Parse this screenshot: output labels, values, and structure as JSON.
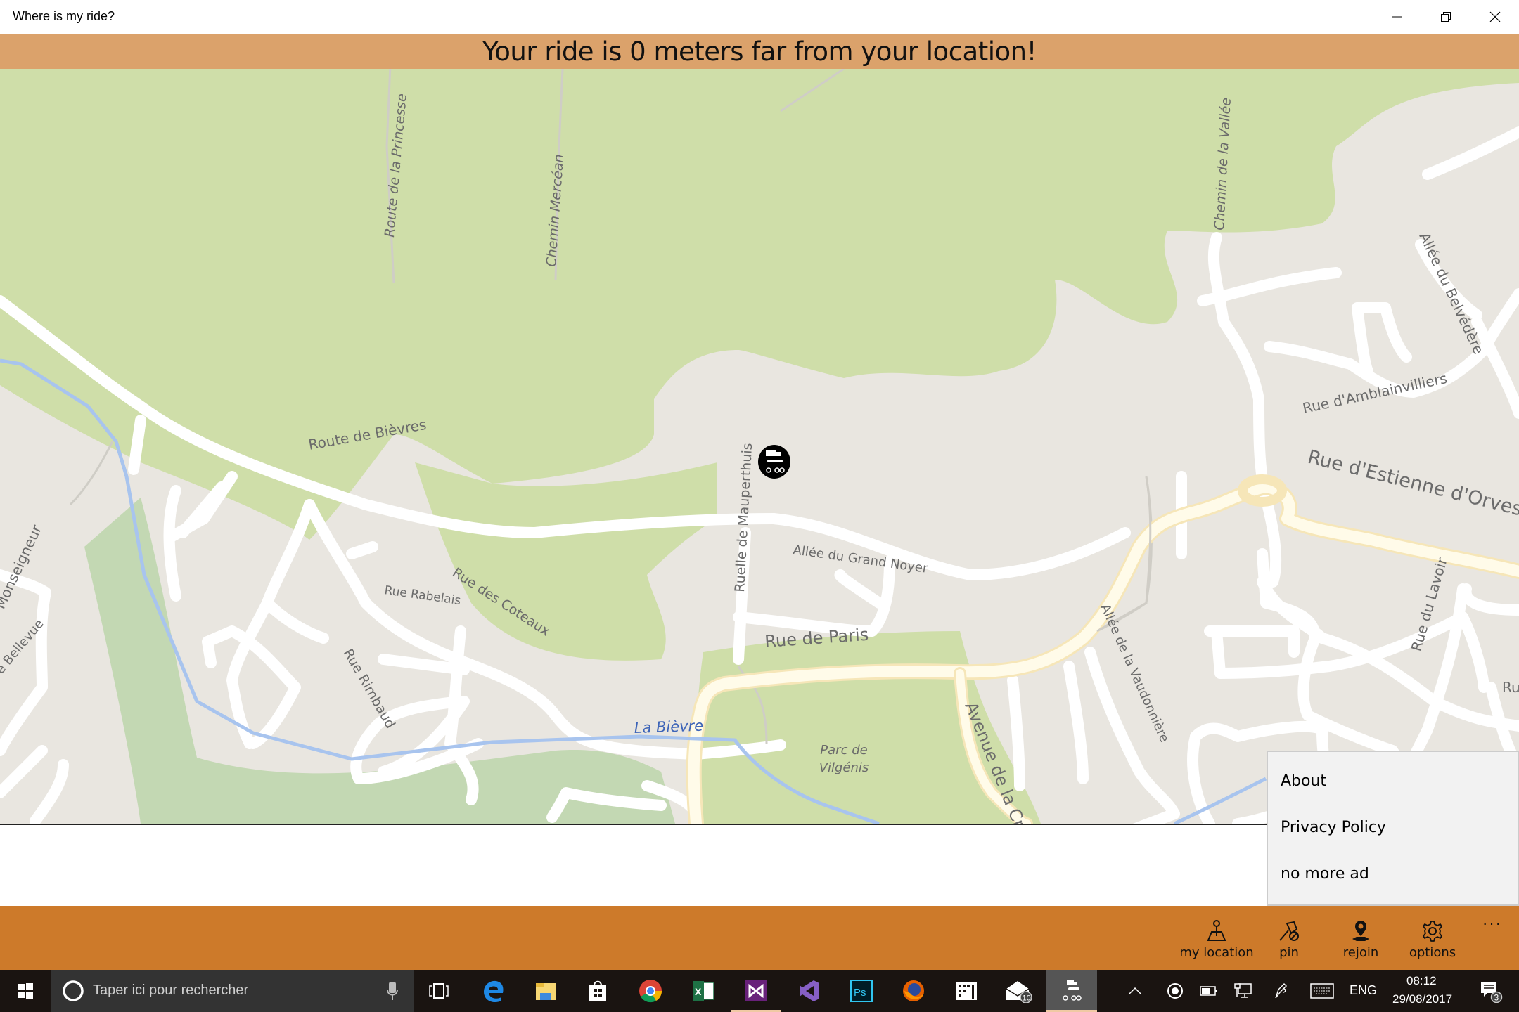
{
  "window": {
    "title": "Where is my ride?",
    "controls": [
      "minimize",
      "restore",
      "close"
    ]
  },
  "banner": {
    "message": "Your ride is 0 meters far from your location!",
    "color": "#dba26b"
  },
  "map": {
    "labels": {
      "route_princesse": "Route de la Princesse",
      "chemin_mercean": "Chemin Mercéan",
      "chemin_vallee": "Chemin de la Vallée",
      "allee_belvedere": "Allée du Belvédère",
      "rue_amblainvilliers": "Rue d'Amblainvilliers",
      "rue_estienne": "Rue d'Estienne d'Orves",
      "route_bievres": "Route de Bièvres",
      "ruelle_mauperthuis": "Ruelle de Mauperthuis",
      "allee_grand_noyer": "Allée du Grand Noyer",
      "rue_coteaux": "Rue des Coteaux",
      "rue_rabelais": "Rue Rabelais",
      "rue_rimbaud": "Rue Rimbaud",
      "monseigneur": "Monseigneur",
      "bellevue": "e Bellevue",
      "rue_paris": "Rue de Paris",
      "la_bievre": "La Bièvre",
      "parc_line1": "Parc de",
      "parc_line2": "Vilgénis",
      "avenue_croix": "Avenue de la Cro",
      "allee_vaudonniere": "Allée de la Vaudonnière",
      "rue_lavoir": "Rue du Lavoir",
      "ru_partial": "Ru"
    },
    "marker": {
      "icon": "vehicle-marker-icon",
      "description": "truck, car, motorbike and bicycle"
    }
  },
  "overflow_menu": {
    "items": [
      {
        "label": "About"
      },
      {
        "label": "Privacy Policy"
      },
      {
        "label": "no more ad"
      }
    ]
  },
  "appbar": {
    "color": "#cd7a2a",
    "buttons": [
      {
        "label": "my location",
        "icon": "my-location-icon"
      },
      {
        "label": "pin",
        "icon": "unpin-icon"
      },
      {
        "label": "rejoin",
        "icon": "rejoin-icon"
      },
      {
        "label": "options",
        "icon": "gear-icon"
      }
    ],
    "more_label": "···"
  },
  "taskbar": {
    "search_placeholder": "Taper ici pour rechercher",
    "apps": [
      "edge",
      "file-explorer",
      "store",
      "chrome",
      "excel",
      "visual-studio",
      "visual-studio-2",
      "photoshop",
      "firefox",
      "calculator-app",
      "mail",
      "where-is-my-ride"
    ],
    "mail_badge": "10",
    "language": "ENG",
    "time": "08:12",
    "date": "29/08/2017",
    "notifications_badge": "3"
  }
}
